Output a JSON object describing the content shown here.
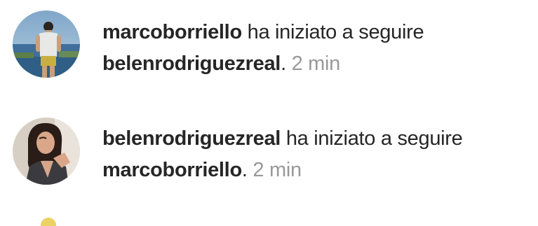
{
  "activity": [
    {
      "actor": "marcoborriello",
      "action": "ha iniziato a seguire",
      "target": "belenrodriguezreal",
      "time": "2 min",
      "avatar_icon": "profile-photo-man-standing-by-sea"
    },
    {
      "actor": "belenrodriguezreal",
      "action": "ha iniziato a seguire",
      "target": "marcoborriello",
      "time": "2 min",
      "avatar_icon": "profile-photo-woman-dark-hair"
    }
  ],
  "colors": {
    "text": "#262626",
    "timestamp": "#999999",
    "background": "#ffffff"
  }
}
